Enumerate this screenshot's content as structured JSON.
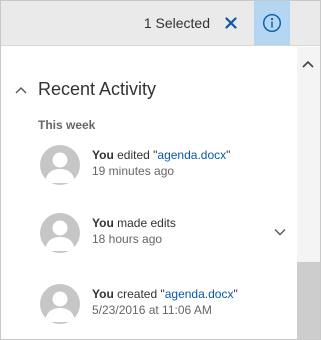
{
  "toolbar": {
    "selected_text": "1 Selected",
    "clear_icon": "close-icon",
    "info_icon": "info-icon",
    "info_active_color": "#b3d6f2"
  },
  "recent_activity": {
    "title": "Recent Activity",
    "expanded": true,
    "group_label": "This week",
    "items": [
      {
        "actor": "You",
        "action_pre": " edited \"",
        "file": "agenda.docx",
        "action_post": "\"",
        "time": "19 minutes ago",
        "expandable": false
      },
      {
        "actor": "You",
        "action_pre": " made edits",
        "file": "",
        "action_post": "",
        "time": "18 hours ago",
        "expandable": true
      },
      {
        "actor": "You",
        "action_pre": " created \"",
        "file": "agenda.docx",
        "action_post": "\"",
        "time": "5/23/2016 at 11:06 AM",
        "expandable": false
      }
    ]
  },
  "colors": {
    "link": "#0b58a8",
    "accent": "#0078d7",
    "toolbar_bg": "#eaeaea"
  }
}
